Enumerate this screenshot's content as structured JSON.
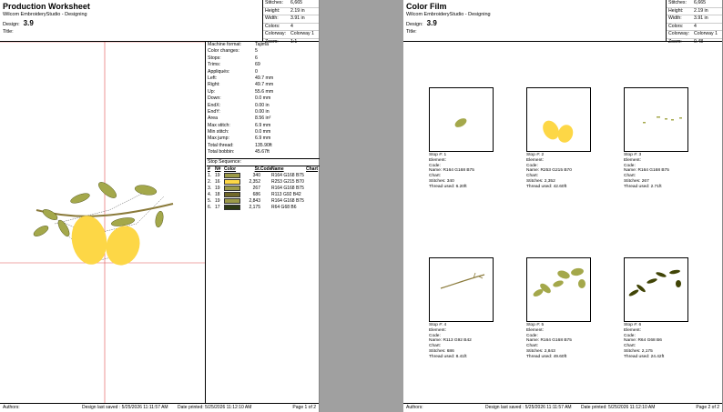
{
  "header_common": {
    "studio": "Wilcom EmbroideryStudio - Designing",
    "design_label": "Design:",
    "design_value": "3.9",
    "title_label": "Title:"
  },
  "left_page": {
    "title": "Production Worksheet",
    "stats": [
      {
        "label": "Stitches:",
        "value": "6,665"
      },
      {
        "label": "Height:",
        "value": "2.19 in"
      },
      {
        "label": "Width:",
        "value": "3.91 in"
      },
      {
        "label": "Colors:",
        "value": "4"
      },
      {
        "label": "Colorway:",
        "value": "Colorway 1"
      },
      {
        "label": "Zoom:",
        "value": "1:1"
      }
    ],
    "info": [
      {
        "label": "Machine format:",
        "value": "Tajima"
      },
      {
        "label": "Color changes:",
        "value": "5"
      },
      {
        "label": "Stops:",
        "value": "6"
      },
      {
        "label": "Trims:",
        "value": "69"
      },
      {
        "label": "Appliqués:",
        "value": "0"
      },
      {
        "label": "Left:",
        "value": "49.7 mm"
      },
      {
        "label": "Right:",
        "value": "49.7 mm"
      },
      {
        "label": "Up:",
        "value": "55.6 mm"
      },
      {
        "label": "Down:",
        "value": "0.0 mm"
      },
      {
        "label": "EndX:",
        "value": "0.00 in"
      },
      {
        "label": "EndY:",
        "value": "0.00 in"
      },
      {
        "label": "Area",
        "value": "8.56 in²"
      },
      {
        "label": "Max stitch:",
        "value": "6.9 mm"
      },
      {
        "label": "Min stitch:",
        "value": "0.0 mm"
      },
      {
        "label": "Max jump:",
        "value": "6.9 mm"
      },
      {
        "label": "Total thread:",
        "value": "135.90ft"
      },
      {
        "label": "Total bobbin:",
        "value": "45.67ft"
      }
    ],
    "sequence_title": "Stop Sequence:",
    "sequence_headers": [
      "#",
      "N#",
      "Color",
      "St.",
      "Code",
      "Name",
      "Chart"
    ],
    "sequence": [
      {
        "n": "1.",
        "needle": "19",
        "color": "#9c9a48",
        "st": "340",
        "name": "R164 G168 B75"
      },
      {
        "n": "2.",
        "needle": "16",
        "color": "#fdd746",
        "st": "2,352",
        "name": "R253 G215 B70"
      },
      {
        "n": "3.",
        "needle": "19",
        "color": "#9c9a48",
        "st": "267",
        "name": "R164 G168 B75"
      },
      {
        "n": "4.",
        "needle": "18",
        "color": "#71682a",
        "st": "686",
        "name": "R113 G92 B42"
      },
      {
        "n": "5.",
        "needle": "19",
        "color": "#9c9a48",
        "st": "2,843",
        "name": "R164 G168 B75"
      },
      {
        "n": "6.",
        "needle": "17",
        "color": "#2e3a14",
        "st": "2,175",
        "name": "R64 G68 B6"
      }
    ],
    "footer": {
      "authors": "Authors:",
      "saved": "Design last saved : 5/25/2026 11:11:57 AM",
      "printed": "Date printed: 5/25/2026 11:12:10 AM",
      "page": "Page 1 of 2"
    }
  },
  "right_page": {
    "title": "Color Film",
    "stats": [
      {
        "label": "Stitches:",
        "value": "6,665"
      },
      {
        "label": "Height:",
        "value": "2.19 in"
      },
      {
        "label": "Width:",
        "value": "3.91 in"
      },
      {
        "label": "Colors:",
        "value": "4"
      },
      {
        "label": "Colorway:",
        "value": "Colorway 1"
      },
      {
        "label": "Zoom:",
        "value": "0.48"
      }
    ],
    "films": [
      {
        "stop": "Stop #: 1",
        "element": "Element:",
        "code": "Code:",
        "name": "Name: R164 G168 B75",
        "chart": "Chart:",
        "stitches": "Stitches: 340",
        "thread": "Thread used: 6.20ft"
      },
      {
        "stop": "Stop #: 2",
        "element": "Element:",
        "code": "Code:",
        "name": "Name: R253 G215 B70",
        "chart": "Chart:",
        "stitches": "Stitches: 2,352",
        "thread": "Thread used: 42.60ft"
      },
      {
        "stop": "Stop #: 3",
        "element": "Element:",
        "code": "Code:",
        "name": "Name: R164 G168 B75",
        "chart": "Chart:",
        "stitches": "Stitches: 267",
        "thread": "Thread used: 2.71ft"
      },
      {
        "stop": "Stop #: 4",
        "element": "Element:",
        "code": "Code:",
        "name": "Name: R113 G92 B42",
        "chart": "Chart:",
        "stitches": "Stitches: 686",
        "thread": "Thread used: 8.41ft"
      },
      {
        "stop": "Stop #: 5",
        "element": "Element:",
        "code": "Code:",
        "name": "Name: R164 G168 B75",
        "chart": "Chart:",
        "stitches": "Stitches: 2,843",
        "thread": "Thread used: 49.60ft"
      },
      {
        "stop": "Stop #: 6",
        "element": "Element:",
        "code": "Code:",
        "name": "Name: R64 G68 B6",
        "chart": "Chart:",
        "stitches": "Stitches: 2,175",
        "thread": "Thread used: 24.42ft"
      }
    ],
    "footer": {
      "authors": "Authors:",
      "saved": "Design last saved : 5/25/2026 11:11:57 AM",
      "printed": "Date printed: 5/25/2026 11:12:10 AM",
      "page": "Page 2 of 2"
    }
  },
  "colors": {
    "leaf": "#a4a84b",
    "lemon": "#fdd746",
    "stem": "#8a7a3a",
    "dark": "#404406",
    "guide": "#e05050"
  }
}
